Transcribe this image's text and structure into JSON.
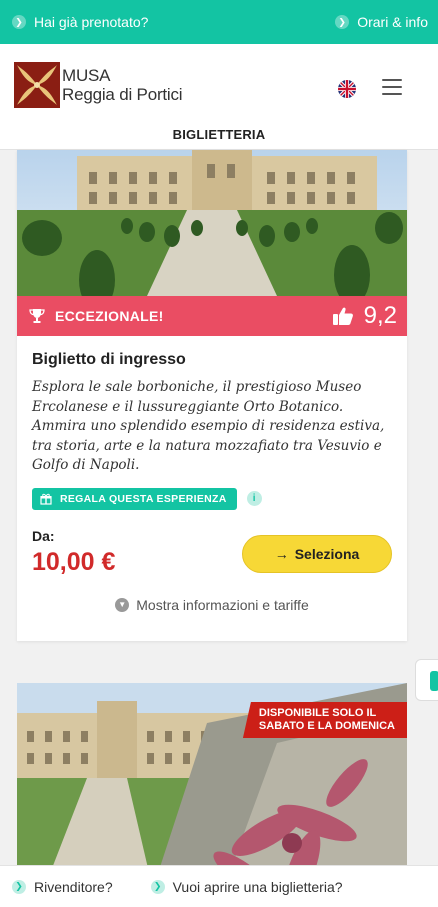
{
  "topbar": {
    "booked_label": "Hai già prenotato?",
    "hours_label": "Orari & info"
  },
  "header": {
    "logo_line1": "MUSA",
    "logo_line2": "Reggia di Portici",
    "language": "English",
    "section_title": "BIGLIETTERIA"
  },
  "colors": {
    "brand_teal": "#13c4a3",
    "rating_red": "#ea4d63",
    "price_red": "#d12a2a",
    "select_yellow": "#f7d836"
  },
  "ticket": {
    "rating_label": "ECCEZIONALE!",
    "rating_value": "9,2",
    "title": "Biglietto di ingresso",
    "description": "Esplora le sale borboniche, il prestigioso Museo Ercolanese e il lussureggiante Orto Botanico. Ammira uno splendido esempio di residenza estiva, tra storia, arte e la natura mozzafiato tra Vesuvio e Golfo di Napoli.",
    "gift_label": "REGALA QUESTA ESPERIENZA",
    "price_label": "Da:",
    "price": "10,00 €",
    "select_label": "Seleziona",
    "more_info_label": "Mostra informazioni e tariffe"
  },
  "ticket2": {
    "banner_line1": "DISPONIBILE SOLO IL",
    "banner_line2": "SABATO E LA DOMENICA"
  },
  "bottombar": {
    "reseller_label": "Rivenditore?",
    "open_office_label": "Vuoi aprire una biglietteria?"
  }
}
